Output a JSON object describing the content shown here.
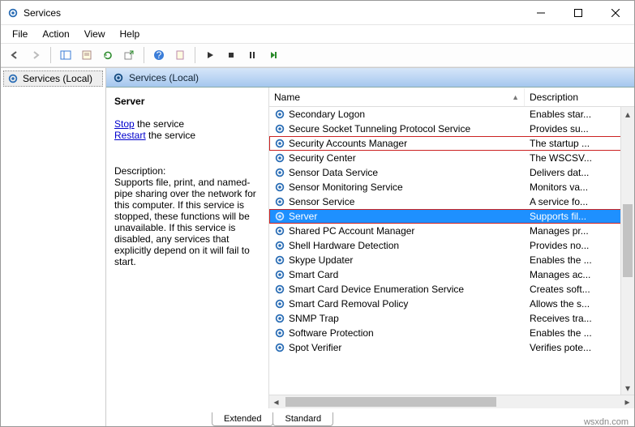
{
  "window": {
    "title": "Services"
  },
  "menu": {
    "file": "File",
    "action": "Action",
    "view": "View",
    "help": "Help"
  },
  "left": {
    "node": "Services (Local)"
  },
  "pane": {
    "header": "Services (Local)"
  },
  "detail": {
    "title": "Server",
    "stop": "Stop",
    "stop_suffix": " the service",
    "restart": "Restart",
    "restart_suffix": " the service",
    "desc_label": "Description:",
    "desc_text": "Supports file, print, and named-pipe sharing over the network for this computer. If this service is stopped, these functions will be unavailable. If this service is disabled, any services that explicitly depend on it will fail to start."
  },
  "columns": {
    "name": "Name",
    "desc": "Description"
  },
  "rows": [
    {
      "name": "Secondary Logon",
      "desc": "Enables star...",
      "selected": false,
      "highlight": false
    },
    {
      "name": "Secure Socket Tunneling Protocol Service",
      "desc": "Provides su...",
      "selected": false,
      "highlight": false
    },
    {
      "name": "Security Accounts Manager",
      "desc": "The startup ...",
      "selected": false,
      "highlight": true
    },
    {
      "name": "Security Center",
      "desc": "The WSCSV...",
      "selected": false,
      "highlight": false
    },
    {
      "name": "Sensor Data Service",
      "desc": "Delivers dat...",
      "selected": false,
      "highlight": false
    },
    {
      "name": "Sensor Monitoring Service",
      "desc": "Monitors va...",
      "selected": false,
      "highlight": false
    },
    {
      "name": "Sensor Service",
      "desc": "A service fo...",
      "selected": false,
      "highlight": false
    },
    {
      "name": "Server",
      "desc": "Supports fil...",
      "selected": true,
      "highlight": true
    },
    {
      "name": "Shared PC Account Manager",
      "desc": "Manages pr...",
      "selected": false,
      "highlight": false
    },
    {
      "name": "Shell Hardware Detection",
      "desc": "Provides no...",
      "selected": false,
      "highlight": false
    },
    {
      "name": "Skype Updater",
      "desc": "Enables the ...",
      "selected": false,
      "highlight": false
    },
    {
      "name": "Smart Card",
      "desc": "Manages ac...",
      "selected": false,
      "highlight": false
    },
    {
      "name": "Smart Card Device Enumeration Service",
      "desc": "Creates soft...",
      "selected": false,
      "highlight": false
    },
    {
      "name": "Smart Card Removal Policy",
      "desc": "Allows the s...",
      "selected": false,
      "highlight": false
    },
    {
      "name": "SNMP Trap",
      "desc": "Receives tra...",
      "selected": false,
      "highlight": false
    },
    {
      "name": "Software Protection",
      "desc": "Enables the ...",
      "selected": false,
      "highlight": false
    },
    {
      "name": "Spot Verifier",
      "desc": "Verifies pote...",
      "selected": false,
      "highlight": false
    }
  ],
  "tabs": {
    "extended": "Extended",
    "standard": "Standard"
  },
  "watermark": "wsxdn.com"
}
